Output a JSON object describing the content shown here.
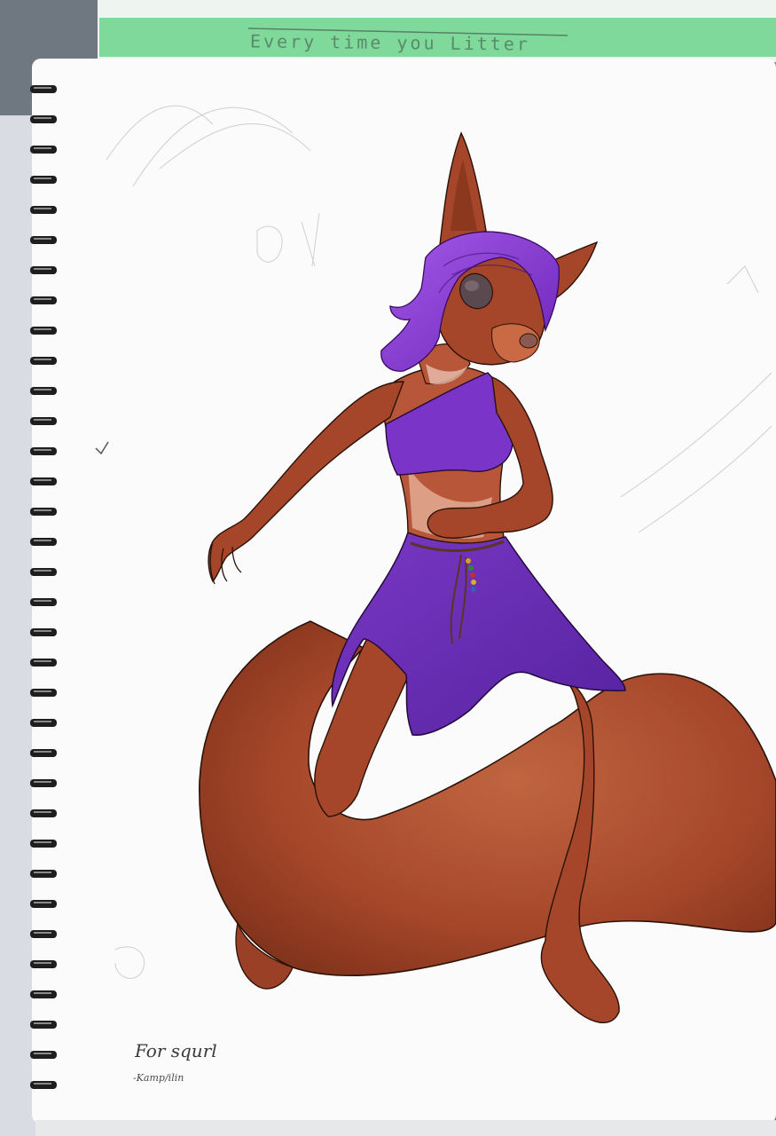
{
  "image": {
    "subject": "anthro-squirrel-drawing",
    "colors": {
      "fur": "#a5462a",
      "fur_dark": "#7a2f18",
      "fur_light": "#c96a45",
      "hair": "#8a3fd2",
      "clothing": "#6a2fb0",
      "paper": "#fbfbfb",
      "green_sheet": "#7ed99a"
    },
    "green_sheet_text": "Every time you Litter",
    "signature": {
      "line1": "For squrl",
      "line2": "-Kamp/ilin"
    }
  }
}
